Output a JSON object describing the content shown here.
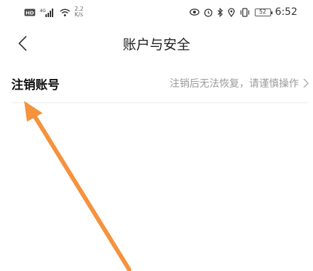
{
  "status_bar": {
    "hd_badge": "HD",
    "signal_label": "4G",
    "net_speed_value": "2.2",
    "net_speed_unit": "K/s",
    "battery_level": "52",
    "time": "6:52",
    "icons": [
      "hd-icon",
      "signal-icon",
      "wifi-icon",
      "eye-icon",
      "alarm-icon",
      "bluetooth-icon",
      "location-icon",
      "vibrate-icon",
      "battery-icon"
    ]
  },
  "nav": {
    "title": "账户与安全",
    "back_icon": "chevron-left-icon"
  },
  "settings": {
    "items": [
      {
        "label": "注销账号",
        "hint": "注销后无法恢复，请谨慎操作"
      }
    ]
  },
  "annotation": {
    "arrow_color": "#f5923e"
  }
}
